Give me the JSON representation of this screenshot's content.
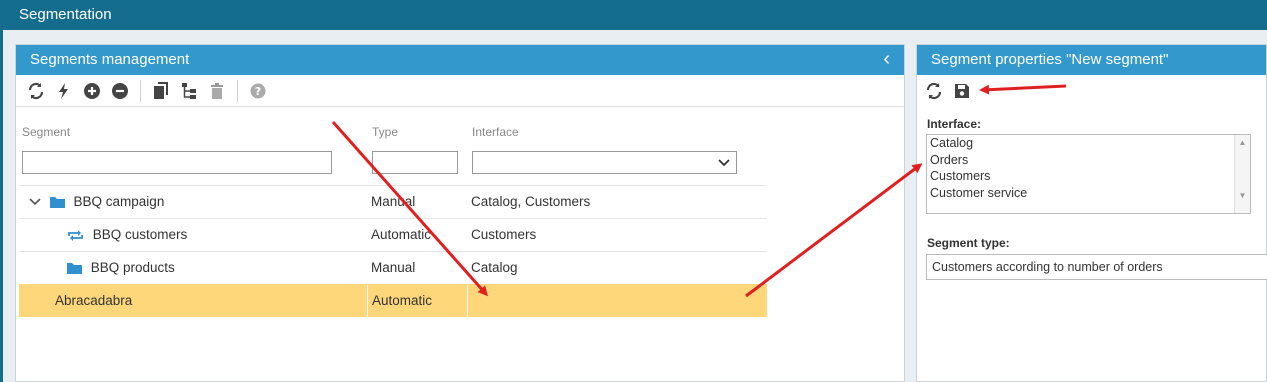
{
  "app": {
    "title": "Segmentation"
  },
  "left_panel": {
    "title": "Segments management",
    "columns": {
      "segment": "Segment",
      "type": "Type",
      "interface": "Interface"
    },
    "filters": {
      "segment": "",
      "type": "",
      "interface": ""
    },
    "rows": [
      {
        "name": "BBQ campaign",
        "type": "Manual",
        "interface": "Catalog, Customers",
        "icon": "folder-icon",
        "expander": "chevron-down-icon"
      },
      {
        "name": "BBQ customers",
        "type": "Automatic",
        "interface": "Customers",
        "icon": "refresh-segment-icon"
      },
      {
        "name": "BBQ products",
        "type": "Manual",
        "interface": "Catalog",
        "icon": "folder-icon"
      },
      {
        "name": "Abracadabra",
        "type": "Automatic",
        "interface": "",
        "selected": true
      }
    ],
    "toolbar_icons": [
      "refresh-icon",
      "lightning-icon",
      "add-circle-icon",
      "remove-circle-icon",
      "copy-icon",
      "tree-icon",
      "trash-icon",
      "help-icon"
    ]
  },
  "right_panel": {
    "title": "Segment properties \"New segment\"",
    "interface_label": "Interface:",
    "interface_options": [
      "Catalog",
      "Orders",
      "Customers",
      "Customer service"
    ],
    "segment_type_label": "Segment type:",
    "segment_type_value": "Customers according to number of orders",
    "toolbar_icons": [
      "refresh-icon",
      "save-icon"
    ]
  },
  "colors": {
    "header": "#156d8e",
    "panel_header": "#3399cc",
    "selected_row": "#fdd77a",
    "annotation_arrow": "#e02020"
  }
}
